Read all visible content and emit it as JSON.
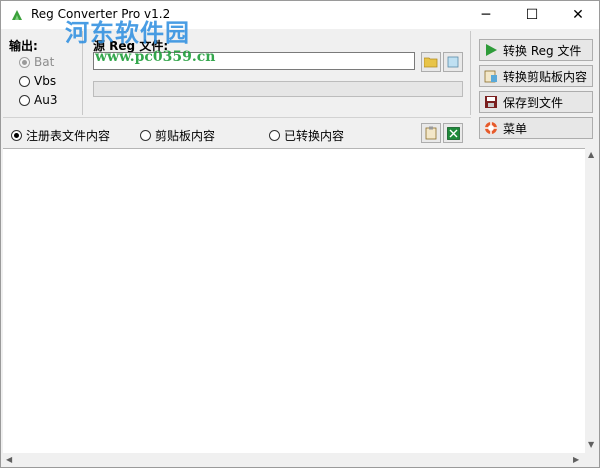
{
  "window": {
    "title": "Reg Converter Pro v1.2",
    "minimize_glyph": "─",
    "maximize_glyph": "☐",
    "close_glyph": "✕"
  },
  "watermark": {
    "text": "河东软件园",
    "url": "www.pc0359.cn"
  },
  "output_group": {
    "label": "输出:",
    "options": [
      {
        "label": "Bat",
        "checked": true,
        "disabled": true
      },
      {
        "label": "Vbs",
        "checked": false,
        "disabled": false
      },
      {
        "label": "Au3",
        "checked": false,
        "disabled": false
      }
    ]
  },
  "source_group": {
    "label": "源 Reg 文件:",
    "file_value": ""
  },
  "view_options": [
    {
      "label": "注册表文件内容",
      "checked": true
    },
    {
      "label": "剪贴板内容",
      "checked": false
    },
    {
      "label": "已转换内容",
      "checked": false
    }
  ],
  "actions": {
    "convert_reg": "转换 Reg 文件",
    "convert_clipboard": "转换剪贴板内容",
    "save_to_file": "保存到文件",
    "menu": "菜单"
  },
  "icons": {
    "open_folder": "folder-open-icon",
    "browse": "document-icon",
    "clipboard": "clipboard-icon",
    "excel": "sheet-icon"
  },
  "colors": {
    "accent_green": "#2e9c3a",
    "folder_yellow": "#e8c448"
  }
}
